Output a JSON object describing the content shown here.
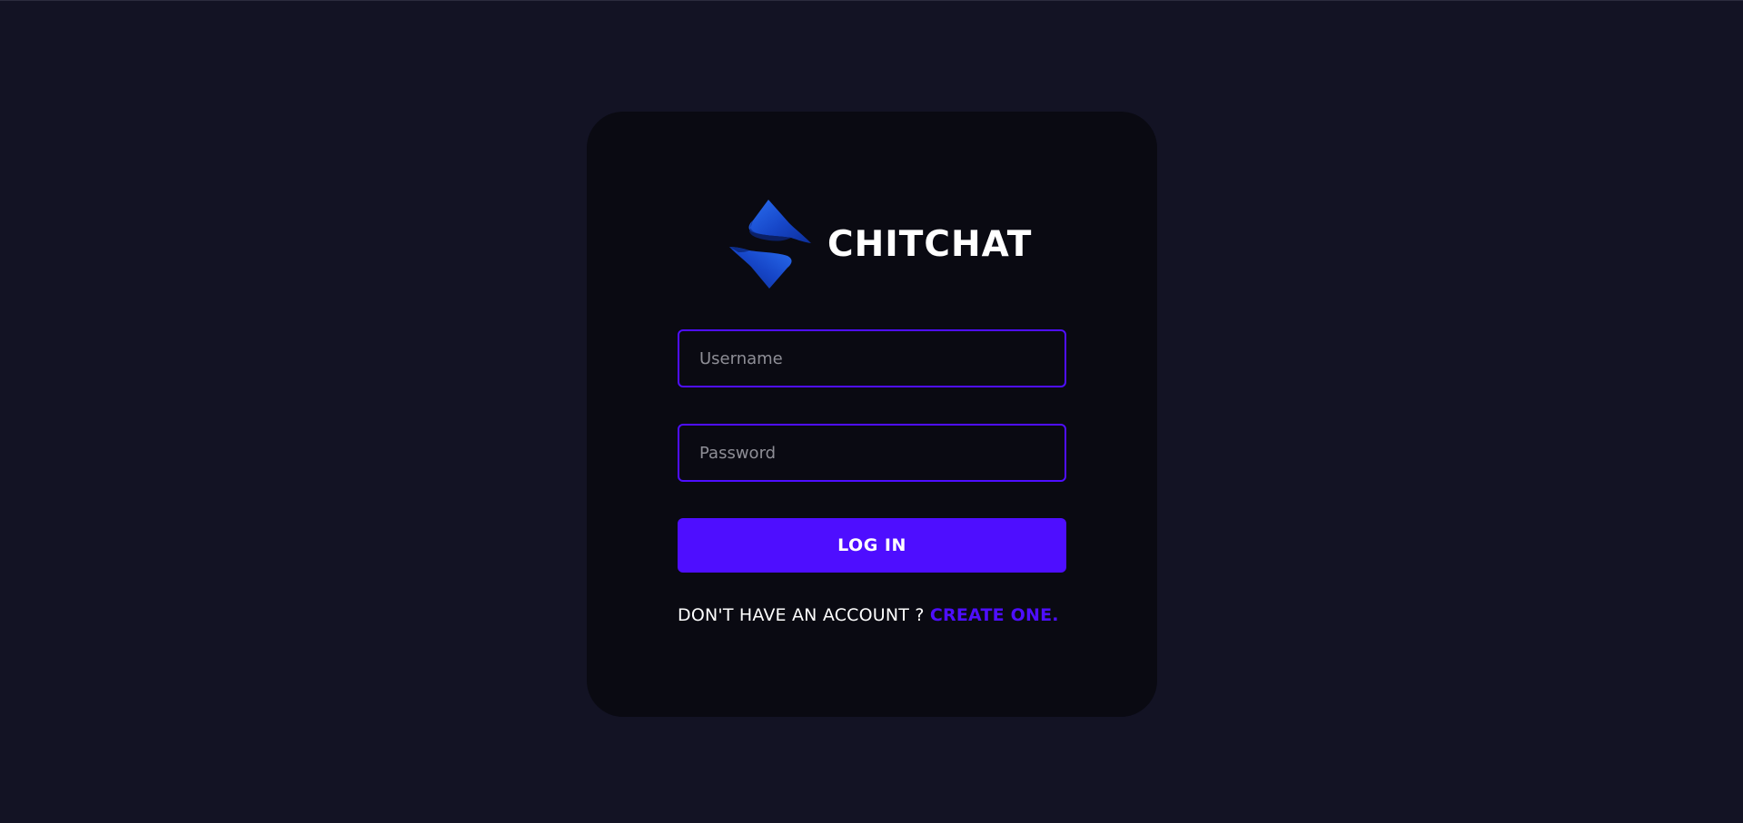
{
  "brand": {
    "name": "CHITCHAT",
    "logo_icon": "chitchat-s-logo-icon"
  },
  "form": {
    "username_placeholder": "Username",
    "username_value": "",
    "password_placeholder": "Password",
    "password_value": "",
    "submit_label": "LOG IN",
    "signup_prompt": "DON'T HAVE AN ACCOUNT ?",
    "signup_link": "CREATE ONE."
  },
  "colors": {
    "page_background": "#131324",
    "card_background": "#0a0a12",
    "accent": "#4e0eff",
    "text": "#ffffff",
    "placeholder": "#8e8e96",
    "logo_blue": "#1a4fd6"
  }
}
